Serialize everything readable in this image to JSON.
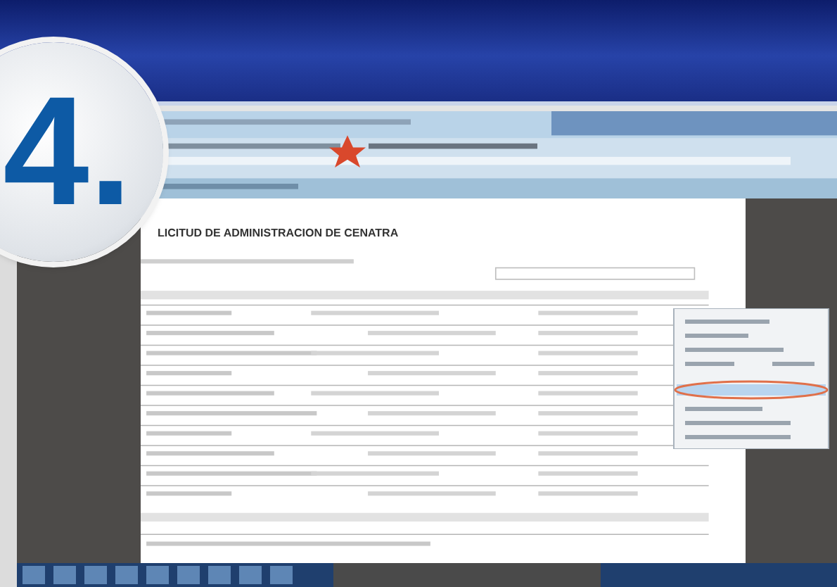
{
  "step_badge": {
    "label": "4."
  },
  "form": {
    "title": "LICITUD DE ADMINISTRACION DE CENATRA"
  }
}
